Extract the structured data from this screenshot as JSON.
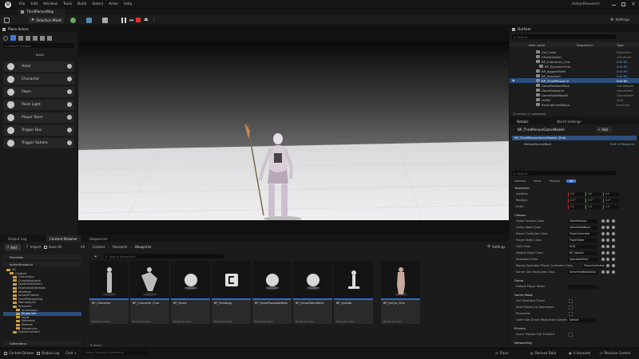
{
  "menu": [
    "File",
    "Edit",
    "Window",
    "Tools",
    "Build",
    "Select",
    "Actor",
    "Help"
  ],
  "project_name": "ActionResearch",
  "level_tab": "ThirdPersonMap",
  "toolbar": {
    "mode": "Selection Mode",
    "settings": "Settings"
  },
  "place_actors": {
    "title": "Place Actors",
    "search_placeholder": "Search Classes",
    "category": "BASIC",
    "items": [
      "Actor",
      "Character",
      "Pawn",
      "Point Light",
      "Player Start",
      "Trigger Box",
      "Trigger Sphere"
    ]
  },
  "outliner": {
    "title": "Outliner",
    "search_placeholder": "Search...",
    "col_label": "Item Label",
    "col_sequencer": "Sequencer",
    "col_type": "Type",
    "rows": [
      {
        "name": "Old_Cube",
        "type": "StaticMes"
      },
      {
        "name": "AIController0",
        "type": "AIControll"
      },
      {
        "name": "BP_Character_Cine",
        "type": "Edit BP_"
      },
      {
        "name": "BP_DynamicCine",
        "type": "Edit BP_"
      },
      {
        "name": "BP_JoggedFbRet",
        "type": "Edit BP_"
      },
      {
        "name": "BP_Spector0",
        "type": "Edit BP_"
      },
      {
        "name": "BP_ThirdPersonCe",
        "type": "Edit BP_"
      },
      {
        "name": "GameNetworkMan",
        "type": "GameNetw"
      },
      {
        "name": "GameSession0",
        "type": "GameSess"
      },
      {
        "name": "GameStateBase0",
        "type": "GameState"
      },
      {
        "name": "HUD0",
        "type": "HUD"
      },
      {
        "name": "ParticleEventMana",
        "type": "ParticleE"
      }
    ],
    "status": "22 actors (1 selected)"
  },
  "details": {
    "tab": "Details",
    "tab2": "World Settings",
    "actor": "BP_ThirdPersonGameMode0",
    "add": "Add",
    "component": "BP_ThirdPersonGameMode0 (Self)",
    "subcomponent": "DefaultSceneRoot",
    "edit_bp": "Edit in Blueprint",
    "search_placeholder": "Search",
    "filter_tabs": [
      "General",
      "Actor",
      "Physics",
      "All"
    ],
    "transform_header": "Transform",
    "transform": [
      {
        "label": "Location",
        "x": "0.0",
        "y": "0.0",
        "z": "0.0"
      },
      {
        "label": "Rotation",
        "x": "0.0°",
        "y": "0.0°",
        "z": "0.0°"
      },
      {
        "label": "Scale",
        "x": "1.0",
        "y": "1.0",
        "z": "1.0"
      }
    ],
    "classes_header": "Classes",
    "classes": [
      {
        "label": "Game Session Class",
        "value": "GameSession"
      },
      {
        "label": "Game State Class",
        "value": "GameStateBase"
      },
      {
        "label": "Player Controller Class",
        "value": "PlayerController"
      },
      {
        "label": "Player State Class",
        "value": "PlayerState"
      },
      {
        "label": "HUD Class",
        "value": "HUD"
      },
      {
        "label": "Default Pawn Class",
        "value": "BP_Spector"
      },
      {
        "label": "Spectator Class",
        "value": "SpectatorPawn"
      },
      {
        "label": "Replay Spectator Player Controller Class",
        "value": "PlayerController"
      },
      {
        "label": "Server Stat Replicator Class",
        "value": "ServerStatReplicator"
      }
    ],
    "game_header": "Game",
    "game_rows": [
      {
        "label": "Default Player Name",
        "value": ""
      }
    ],
    "gamemode_header": "Game Mode",
    "gamemode_rows": [
      {
        "label": "Use Seamless Travel"
      },
      {
        "label": "Start Players as Spectators"
      },
      {
        "label": "Pauseable"
      },
      {
        "label": "Game Net Driver Replication System",
        "value": "Default"
      }
    ],
    "physics_header": "Physics",
    "physics_rows": [
      {
        "label": "Async Physics Tick Enabled"
      }
    ],
    "networking_header": "Networking"
  },
  "bottom_tabs": [
    "Output Log",
    "Content Browser",
    "Sequencer"
  ],
  "content_browser": {
    "add": "Add",
    "import": "Import",
    "save_all": "Save All",
    "breadcrumb": [
      "All",
      "Content",
      "Research",
      "Blueprints"
    ],
    "settings": "Settings",
    "search_placeholder": "Search Blueprints",
    "favorites": "Favorites",
    "project": "ActionResearch",
    "tree": [
      "All",
      "Content",
      "Characters",
      "CLazybsImpack",
      "DynamicDinners",
      "EssentialAnimation",
      "IdleFaker",
      "ImpactFrames",
      "LevelPrototyping",
      "Mannequins",
      "Research",
      "Animations",
      "Blueprints",
      "Input",
      "Materials",
      "Meshes",
      "Sequences",
      "StarterContent"
    ],
    "collections": "Collections",
    "items_count": "8 items",
    "assets": [
      {
        "name": "BP_Character",
        "class": "Blueprint Class"
      },
      {
        "name": "BP_Character_Cine",
        "class": "Blueprint Class"
      },
      {
        "name": "BP_Ghost",
        "class": "Blueprint Class"
      },
      {
        "name": "BP_Ghosting",
        "class": "Blueprint Class"
      },
      {
        "name": "BP_GhostPoseableMesh",
        "class": "Blueprint Class"
      },
      {
        "name": "BP_GhostStaticMesh",
        "class": "Blueprint Class"
      },
      {
        "name": "BP_Spector",
        "class": "Blueprint Class"
      },
      {
        "name": "BP_ZaYya_Cine",
        "class": "Blueprint Class"
      }
    ]
  },
  "statusbar": {
    "content_drawer": "Content Drawer",
    "output_log": "Output Log",
    "cmd": "Cmd",
    "console_placeholder": "Enter Console Command",
    "trace": "Trace",
    "derived_data": "Derived Data",
    "unsaved": "4 Unsaved",
    "revision_control": "Revision Control"
  }
}
